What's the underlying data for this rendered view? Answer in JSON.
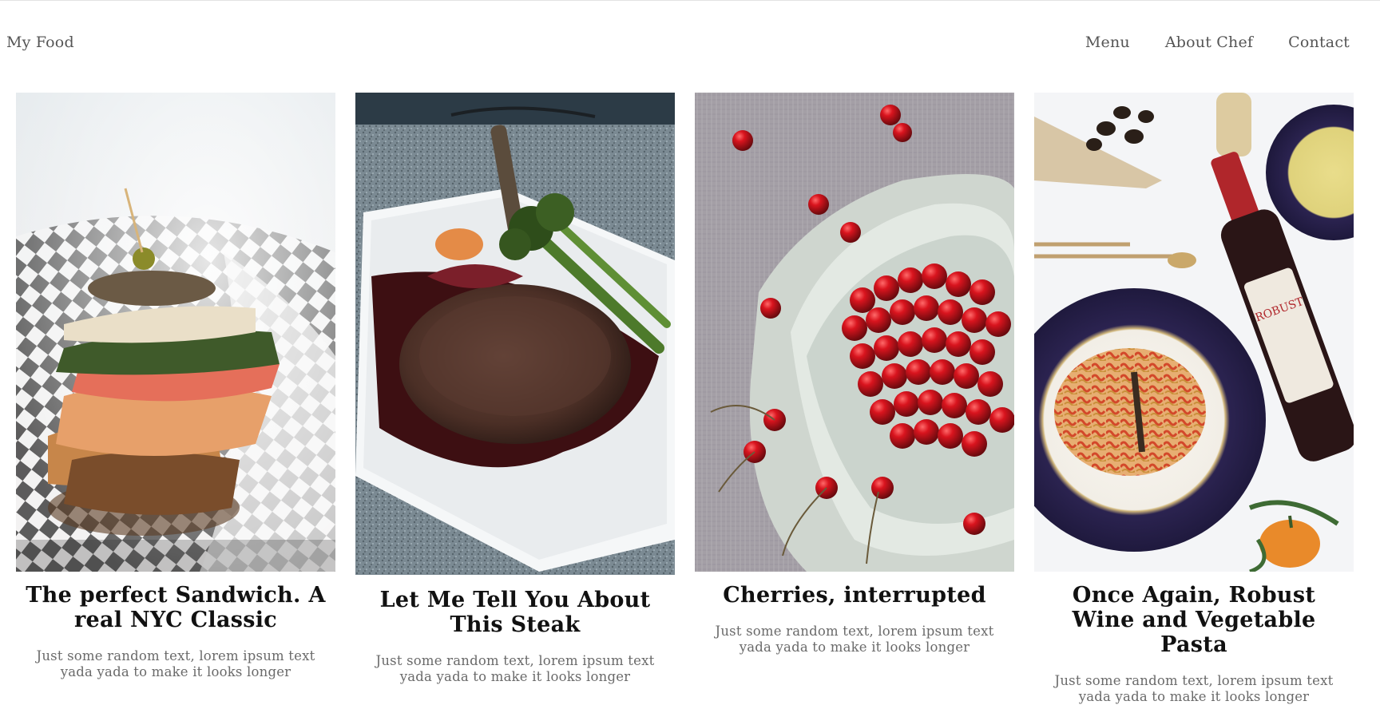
{
  "header": {
    "brand": "My Food",
    "nav": [
      {
        "label": "Menu"
      },
      {
        "label": "About Chef"
      },
      {
        "label": "Contact"
      }
    ]
  },
  "cards": [
    {
      "image": "sandwich-photo",
      "title": "The perfect Sandwich. A real NYC Classic",
      "description": "Just some random text, lorem ipsum text yada yada to make it looks longer"
    },
    {
      "image": "steak-photo",
      "title": "Let Me Tell You About This Steak",
      "description": "Just some random text, lorem ipsum text yada yada to make it looks longer"
    },
    {
      "image": "cherries-photo",
      "title": "Cherries, interrupted",
      "description": "Just some random text, lorem ipsum text yada yada to make it looks longer"
    },
    {
      "image": "wine-pasta-photo",
      "title": "Once Again, Robust Wine and Vegetable Pasta",
      "description": "Just some random text, lorem ipsum text yada yada to make it looks longer",
      "bottle_label": "ROBUST"
    }
  ],
  "colors": {
    "text": "#111111",
    "muted": "#6a6a6a",
    "nav": "#555555"
  }
}
